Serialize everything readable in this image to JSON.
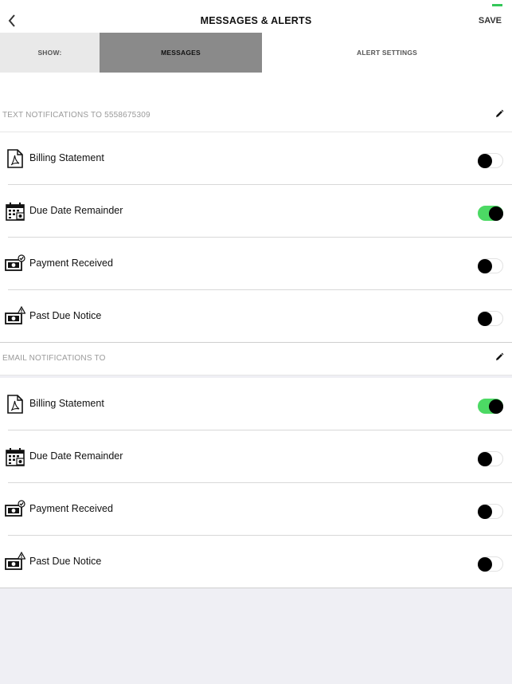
{
  "header": {
    "title": "MESSAGES & ALERTS",
    "save_label": "SAVE",
    "back_icon": "chevron-left-icon"
  },
  "tabs": [
    {
      "label": "SHOW:",
      "state": "static"
    },
    {
      "label": "MESSAGES",
      "state": "selected"
    },
    {
      "label": "ALERT SETTINGS",
      "state": "unselected"
    }
  ],
  "sections": [
    {
      "label": "TEXT NOTIFICATIONS TO 5558675309",
      "items": [
        {
          "label": "Billing Statement",
          "icon": "pdf-document-icon",
          "enabled": false
        },
        {
          "label": "Due Date Remainder",
          "icon": "calendar-icon",
          "enabled": true
        },
        {
          "label": "Payment Received",
          "icon": "payment-received-icon",
          "enabled": false
        },
        {
          "label": "Past Due Notice",
          "icon": "past-due-warning-icon",
          "enabled": false
        }
      ]
    },
    {
      "label": "EMAIL NOTIFICATIONS TO",
      "items": [
        {
          "label": "Billing Statement",
          "icon": "pdf-document-icon",
          "enabled": true
        },
        {
          "label": "Due Date Remainder",
          "icon": "calendar-icon",
          "enabled": false
        },
        {
          "label": "Payment Received",
          "icon": "payment-received-icon",
          "enabled": false
        },
        {
          "label": "Past Due Notice",
          "icon": "past-due-warning-icon",
          "enabled": false
        }
      ]
    }
  ],
  "colors": {
    "toggle_on": "#4cd964",
    "tab_selected_bg": "#8a8a8a",
    "tab_show_bg": "#e9e9e9",
    "page_bg": "#efeff4"
  }
}
